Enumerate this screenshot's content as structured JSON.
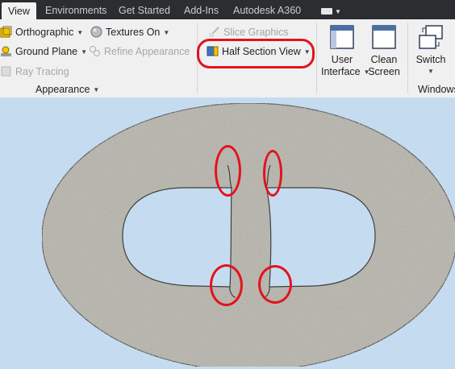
{
  "tabs": [
    {
      "label": "View",
      "active": true
    },
    {
      "label": "Environments"
    },
    {
      "label": "Get Started"
    },
    {
      "label": "Add-Ins"
    },
    {
      "label": "Autodesk A360"
    }
  ],
  "appearance": {
    "orthographic": "Orthographic",
    "textures_on": "Textures On",
    "ground_plane": "Ground Plane",
    "refine_appearance": "Refine Appearance",
    "ray_tracing": "Ray Tracing",
    "panel_label": "Appearance"
  },
  "slice_graphics": "Slice Graphics",
  "half_section_view": "Half Section View",
  "windows": {
    "user_interface": [
      "User",
      "Interface"
    ],
    "clean_screen": [
      "Clean",
      "Screen"
    ],
    "switch": "Switch",
    "panel_label": "Windows"
  },
  "colors": {
    "highlight": "#e3131b",
    "viewport_bg": "#c5dcf0",
    "tab_bar": "#2b2d30"
  }
}
